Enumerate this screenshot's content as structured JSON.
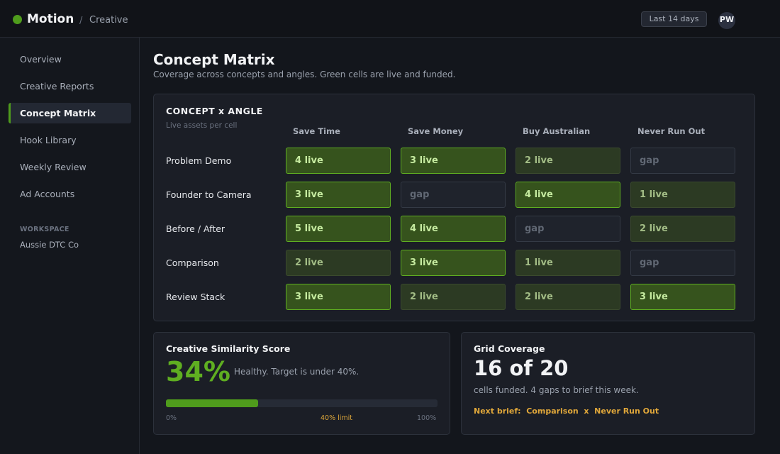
{
  "header": {
    "brand": "Motion",
    "breadcrumb_sep": "/",
    "breadcrumb": "Creative",
    "date_range": "Last 14 days",
    "avatar_initials": "PW"
  },
  "sidebar": {
    "items": [
      {
        "label": "Overview",
        "active": false
      },
      {
        "label": "Creative Reports",
        "active": false
      },
      {
        "label": "Concept Matrix",
        "active": true
      },
      {
        "label": "Hook Library",
        "active": false
      },
      {
        "label": "Weekly Review",
        "active": false
      },
      {
        "label": "Ad Accounts",
        "active": false
      }
    ],
    "workspace_label": "WORKSPACE",
    "workspace_name": "Aussie DTC Co"
  },
  "page": {
    "title": "Concept Matrix",
    "subtitle": "Coverage across concepts and angles. Green cells are live and funded."
  },
  "matrix": {
    "title": "CONCEPT x ANGLE",
    "subtitle": "Live assets per cell",
    "columns": [
      "Save Time",
      "Save Money",
      "Buy Australian",
      "Never Run Out"
    ],
    "rows": [
      {
        "label": "Problem Demo",
        "cells": [
          {
            "text": "4 live",
            "state": "strong"
          },
          {
            "text": "3 live",
            "state": "strong"
          },
          {
            "text": "2 live",
            "state": "weak"
          },
          {
            "text": "gap",
            "state": "gap"
          }
        ]
      },
      {
        "label": "Founder to Camera",
        "cells": [
          {
            "text": "3 live",
            "state": "strong"
          },
          {
            "text": "gap",
            "state": "gap"
          },
          {
            "text": "4 live",
            "state": "strong"
          },
          {
            "text": "1 live",
            "state": "weak"
          }
        ]
      },
      {
        "label": "Before / After",
        "cells": [
          {
            "text": "5 live",
            "state": "strong"
          },
          {
            "text": "4 live",
            "state": "strong"
          },
          {
            "text": "gap",
            "state": "gap"
          },
          {
            "text": "2 live",
            "state": "weak"
          }
        ]
      },
      {
        "label": "Comparison",
        "cells": [
          {
            "text": "2 live",
            "state": "weak"
          },
          {
            "text": "3 live",
            "state": "strong"
          },
          {
            "text": "1 live",
            "state": "weak"
          },
          {
            "text": "gap",
            "state": "gap"
          }
        ]
      },
      {
        "label": "Review Stack",
        "cells": [
          {
            "text": "3 live",
            "state": "strong"
          },
          {
            "text": "2 live",
            "state": "weak"
          },
          {
            "text": "2 live",
            "state": "weak"
          },
          {
            "text": "3 live",
            "state": "strong"
          }
        ]
      }
    ]
  },
  "similarity": {
    "title": "Creative Similarity Score",
    "value": "34%",
    "note": "Healthy. Target is under 40%.",
    "progress_fraction": 0.34,
    "tick_min": "0%",
    "tick_limit": "40% limit",
    "tick_max": "100%"
  },
  "coverage": {
    "title": "Grid Coverage",
    "value": "16 of 20",
    "note": "cells funded. 4 gaps to brief this week.",
    "next_brief": "Next brief:  Comparison  x  Never Run Out"
  },
  "colors": {
    "accent": "#4f9c1c",
    "warning": "#e0a73a",
    "background": "#13161c"
  }
}
